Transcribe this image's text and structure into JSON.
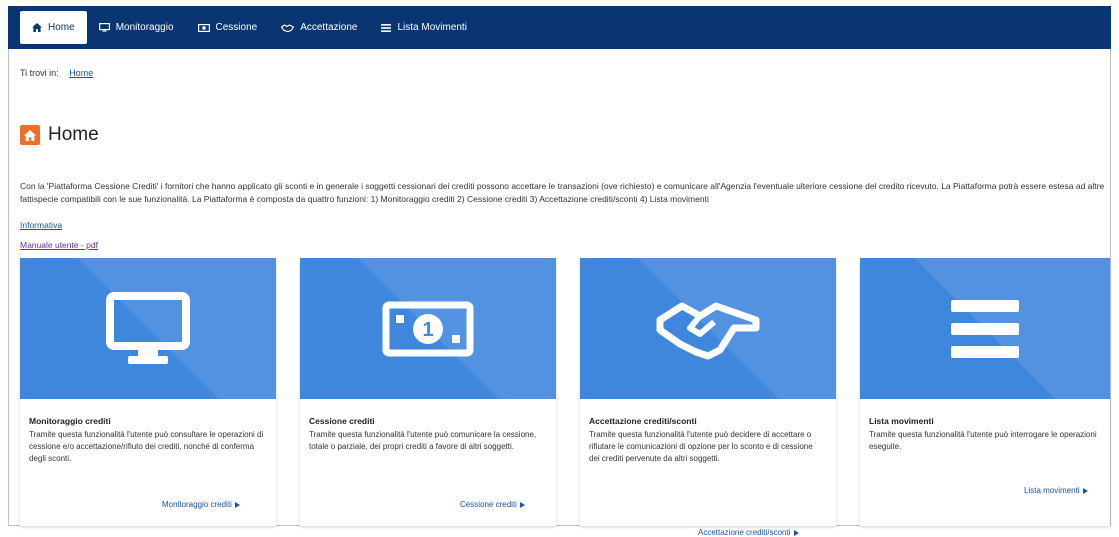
{
  "nav": {
    "items": [
      {
        "label": "Home",
        "icon": "home-icon",
        "active": true
      },
      {
        "label": "Monitoraggio",
        "icon": "monitor-icon",
        "active": false
      },
      {
        "label": "Cessione",
        "icon": "banknote-icon",
        "active": false
      },
      {
        "label": "Accettazione",
        "icon": "handshake-icon",
        "active": false
      },
      {
        "label": "Lista Movimenti",
        "icon": "list-icon",
        "active": false
      }
    ]
  },
  "breadcrumb": {
    "prefix": "Ti trovi in:",
    "current": "Home"
  },
  "page": {
    "title": "Home",
    "intro": "Con la 'Piattaforma Cessione Crediti' i fornitori che hanno applicato gli sconti e in generale i soggetti cessionari dei crediti possono accettare le transazioni (ove richiesto) e comunicare all'Agenzia l'eventuale ulteriore cessione del credito ricevuto. La Piattaforma potrà essere estesa ad altre fattispecie compatibili con le sue funzionalità. La Piattaforma è composta da quattro funzioni: 1) Monitoraggio crediti 2) Cessione crediti 3) Accettazione crediti/sconti 4) Lista movimenti",
    "info_link": "Informativa",
    "manual_link": "Manuale utente - pdf"
  },
  "cards": [
    {
      "icon": "monitor-icon",
      "title": "Monitoraggio crediti",
      "description": "Tramite questa funzionalità l'utente può consultare le operazioni di cessione e/o accettazione/rifiuto dei crediti, nonché di conferma degli sconti.",
      "link": "Monitoraggio crediti"
    },
    {
      "icon": "banknote-icon",
      "title": "Cessione crediti",
      "description": "Tramite questa funzionalità l'utente può comunicare la cessione, totale o parziale, dei propri crediti a favore di altri soggetti.",
      "link": "Cessione crediti"
    },
    {
      "icon": "handshake-icon",
      "title": "Accettazione crediti/sconti",
      "description": "Tramite questa funzionalità l'utente può decidere di accettare o rifiutare le comunicazioni di opzione per lo sconto e di cessione dei crediti pervenute da altri soggetti.",
      "link": "Accettazione crediti/sconti"
    },
    {
      "icon": "list-icon",
      "title": "Lista movimenti",
      "description": "Tramite questa funzionalità l'utente può interrogare le operazioni eseguite.",
      "link": "Lista movimenti"
    }
  ],
  "colors": {
    "navbar": "#0a3573",
    "card_blue": "#3f86dd",
    "accent_orange": "#e8702a",
    "link": "#1a55a8"
  }
}
